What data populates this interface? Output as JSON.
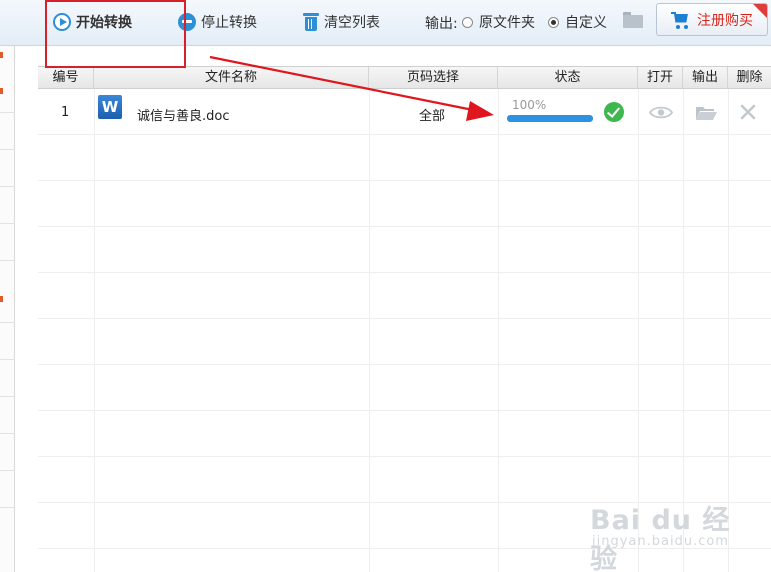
{
  "toolbar": {
    "start_label": "开始转换",
    "stop_label": "停止转换",
    "clear_label": "清空列表",
    "output_label": "输出:",
    "option_original": "原文件夹",
    "option_custom": "自定义",
    "selected_option": "自定义",
    "buy_label": "注册购买"
  },
  "table": {
    "headers": [
      "编号",
      "文件名称",
      "页码选择",
      "状态",
      "打开",
      "输出",
      "删除"
    ],
    "rows": [
      {
        "index": "1",
        "file_icon_letter": "W",
        "file_name": "诚信与善良.doc",
        "pages": "全部",
        "progress_text": "100%",
        "progress_fraction": 1.0,
        "status": "done"
      }
    ]
  },
  "watermark": {
    "main": "Bai du 经验",
    "sub": "jingyan.baidu.com"
  },
  "colors": {
    "accent": "#2d8fd6",
    "annotation_red": "#d6202a",
    "success_green": "#3cb84e",
    "buy_red": "#d9261c"
  },
  "icons": [
    "play-icon",
    "stop-icon",
    "trash-icon",
    "folder-icon",
    "cart-icon",
    "word-icon",
    "check-icon",
    "eye-icon",
    "open-folder-icon",
    "delete-icon"
  ]
}
